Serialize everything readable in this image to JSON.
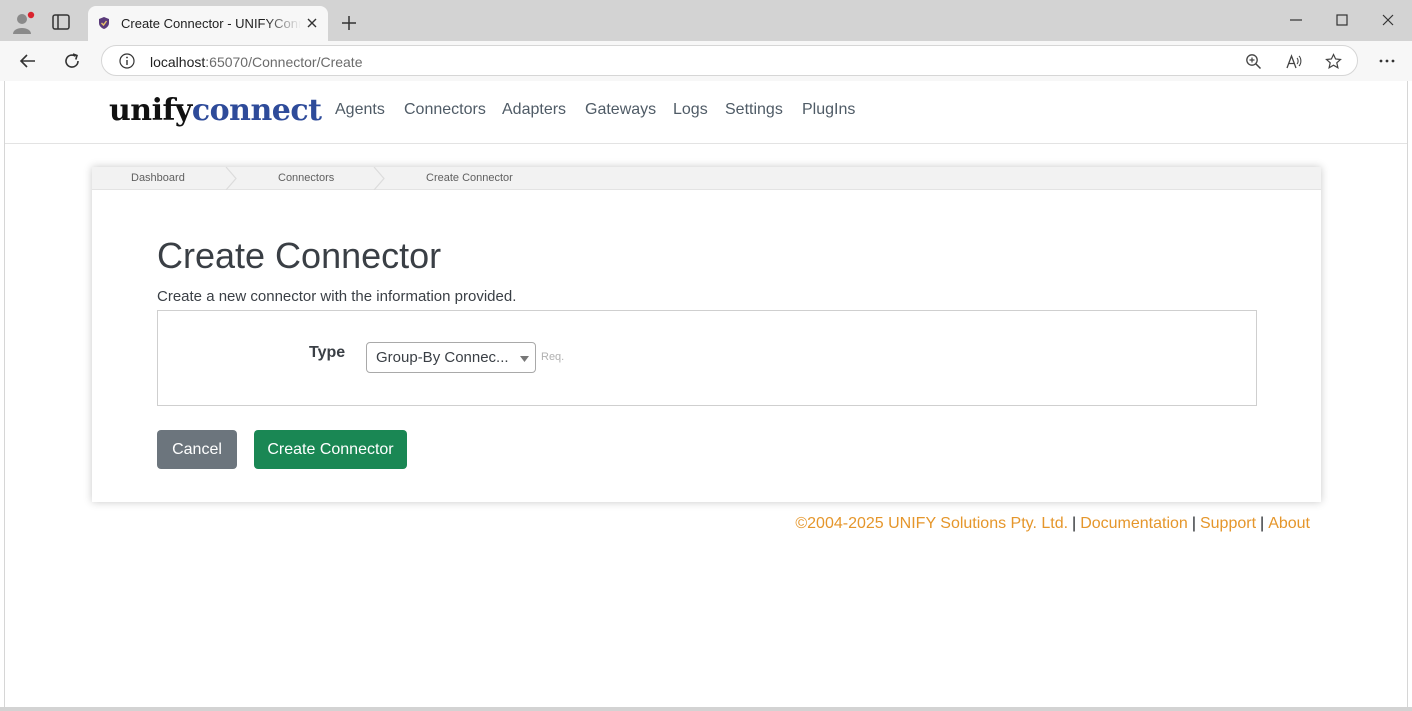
{
  "browser": {
    "tab_title": "Create Connector - UNIFYConnect",
    "url_host": "localhost",
    "url_rest": ":65070/Connector/Create"
  },
  "site": {
    "brand_part1": "unify",
    "brand_part2": "connect",
    "nav": [
      "Agents",
      "Connectors",
      "Adapters",
      "Gateways",
      "Logs",
      "Settings",
      "PlugIns"
    ]
  },
  "breadcrumb": [
    "Dashboard",
    "Connectors",
    "Create Connector"
  ],
  "form": {
    "title": "Create Connector",
    "subtitle": "Create a new connector with the information provided.",
    "type_label": "Type",
    "type_value": "Group-By Connec...",
    "required_hint": "Req.",
    "cancel_label": "Cancel",
    "submit_label": "Create Connector"
  },
  "footer": {
    "copyright": "©2004-2025 UNIFY Solutions Pty. Ltd.",
    "documentation": "Documentation",
    "support": "Support",
    "about": "About",
    "separator": "|"
  },
  "colors": {
    "brand_accent": "#2e4b9a",
    "cancel_button": "#6c757d",
    "create_button": "#1a8754",
    "footer_link": "#e5962b"
  }
}
